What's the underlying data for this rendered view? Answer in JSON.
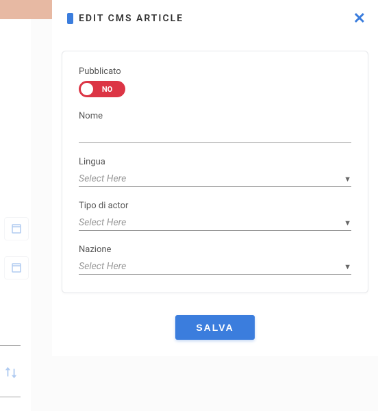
{
  "modal": {
    "title": "EDIT CMS ARTICLE"
  },
  "form": {
    "pubblicato": {
      "label": "Pubblicato",
      "value_label": "NO"
    },
    "nome": {
      "label": "Nome",
      "value": ""
    },
    "lingua": {
      "label": "Lingua",
      "placeholder": "Select Here"
    },
    "tipo": {
      "label": "Tipo di actor",
      "placeholder": "Select Here"
    },
    "nazione": {
      "label": "Nazione",
      "placeholder": "Select Here"
    }
  },
  "actions": {
    "save": "SALVA"
  }
}
